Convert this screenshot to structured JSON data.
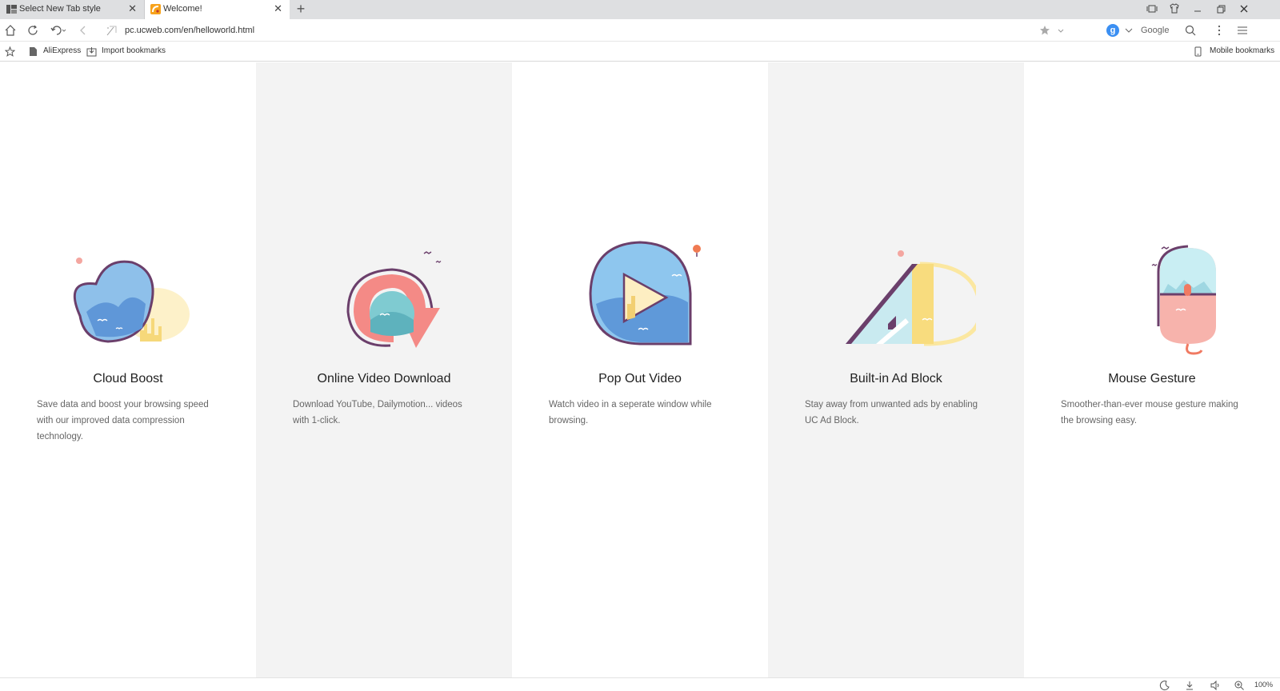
{
  "tabs": [
    {
      "label": "Select New Tab style"
    },
    {
      "label": "Welcome!"
    }
  ],
  "tab_close_glyph": "✕",
  "new_tab_glyph": "+",
  "address": {
    "url": "pc.ucweb.com/en/helloworld.html",
    "search_engine": "Google",
    "engine_letter": "g"
  },
  "bookmarks": [
    {
      "label": "AliExpress"
    },
    {
      "label": "Import bookmarks"
    }
  ],
  "mobile_bookmarks": "Mobile bookmarks",
  "features": [
    {
      "title": "Cloud Boost",
      "description": "Save data and boost your browsing speed with our improved data compression technology."
    },
    {
      "title": "Online Video Download",
      "description": "Download YouTube, Dailymotion... videos with 1-click."
    },
    {
      "title": "Pop Out Video",
      "description": "Watch video in a seperate window while browsing."
    },
    {
      "title": "Built-in Ad Block",
      "description": "Stay away from unwanted ads by enabling UC Ad Block."
    },
    {
      "title": "Mouse Gesture",
      "description": "Smoother-than-ever mouse gesture making the browsing easy."
    }
  ],
  "status": {
    "zoom": "100%"
  },
  "colors": {
    "accent": "#3b8ff2",
    "panel_shade": "#f3f3f3",
    "illus_outline": "#6b3f6b"
  }
}
